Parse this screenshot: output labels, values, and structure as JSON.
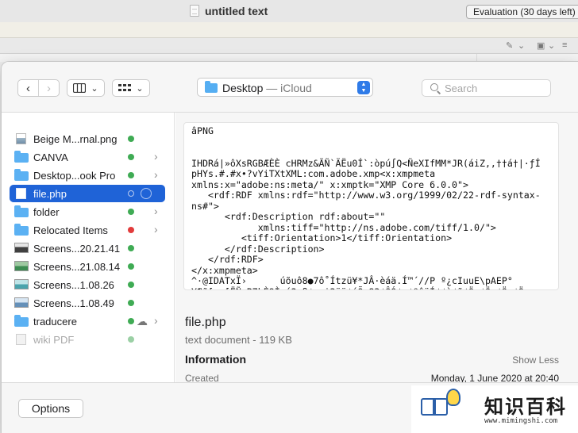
{
  "editor": {
    "title": "untitled text",
    "evaluation_badge": "Evaluation (30 days left)"
  },
  "dialog": {
    "location": {
      "folder": "Desktop",
      "separator": " — ",
      "provider": "iCloud"
    },
    "search_placeholder": "Search",
    "sidebar": {
      "items": [
        {
          "label": "Beige M...rnal.png",
          "icon": "image-file-icon",
          "status": "synced"
        },
        {
          "label": "CANVA",
          "icon": "folder-icon",
          "status": "synced"
        },
        {
          "label": "Desktop...ook Pro",
          "icon": "folder-icon",
          "status": "synced"
        },
        {
          "label": "file.php",
          "icon": "php-file-icon",
          "status": "syncing"
        },
        {
          "label": "folder",
          "icon": "folder-icon",
          "status": "synced"
        },
        {
          "label": "Relocated Items",
          "icon": "folder-icon",
          "status": "error"
        },
        {
          "label": "Screens...20.21.41",
          "icon": "screenshot-icon",
          "status": "synced"
        },
        {
          "label": "Screens...21.08.14",
          "icon": "screenshot-icon",
          "status": "synced"
        },
        {
          "label": "Screens...1.08.26",
          "icon": "screenshot-icon",
          "status": "synced"
        },
        {
          "label": "Screens...1.08.49",
          "icon": "screenshot-icon",
          "status": "synced"
        },
        {
          "label": "traducere",
          "icon": "folder-icon",
          "status": "synced"
        },
        {
          "label": "wiki PDF",
          "icon": "pdf-file-icon",
          "status": "synced"
        }
      ]
    },
    "preview": {
      "content": "âPNG\n\n\nIHDRá|»ôXsRGBÆÈÈ cHRMz&ÃÑ`ÄËu0Í`:òpú∫Q<ÑeXIfMM*JR(áiZ,,††á†|·ƒÍ\npHYs.#.#x•?vYiTXtXML:com.adobe.xmp<x:xmpmeta\nxmlns:x=\"adobe:ns:meta/\" x:xmptk=\"XMP Core 6.0.0\">\n   <rdf:RDF xmlns:rdf=\"http://www.w3.org/1999/02/22-rdf-syntax-\nns#\">\n      <rdf:Description rdf:about=\"\"\n            xmlns:tiff=\"http://ns.adobe.com/tiff/1.0/\">\n         <tiff:Orientation>1</tiff:Orientation>\n      </rdf:Description>\n   </rdf:RDF>\n</x:xmpmeta>\n^·@IDATxÏ›      úõuô8●7ô˚Ítzü¥*JÂ·èáä.Í™´//P º¿cIuuE\\pAEP°\nY¶ñ[·:[ËÑ B7bÈ9Ì;ú3 ß¢g:˙3öÿ¢úÕ¬83¢ÔÓ¢ ¢ºêüÍ¢¢ù¢ñ¢Ö ¢Ö ¢Ö ¢Ö",
      "filename": "file.php",
      "kind_size": "text document - 119 KB",
      "info_heading": "Information",
      "show_less": "Show Less",
      "created_label": "Created",
      "created_value": "Monday, 1 June 2020 at 20:40"
    },
    "options_label": "Options"
  },
  "watermark": {
    "chinese": "知识百科",
    "url": "www.mimingshi.com"
  },
  "colors": {
    "selection": "#1f63d7",
    "sync_green": "#3fab54",
    "error_red": "#e23b3b",
    "folder_blue": "#5bb1f3"
  }
}
